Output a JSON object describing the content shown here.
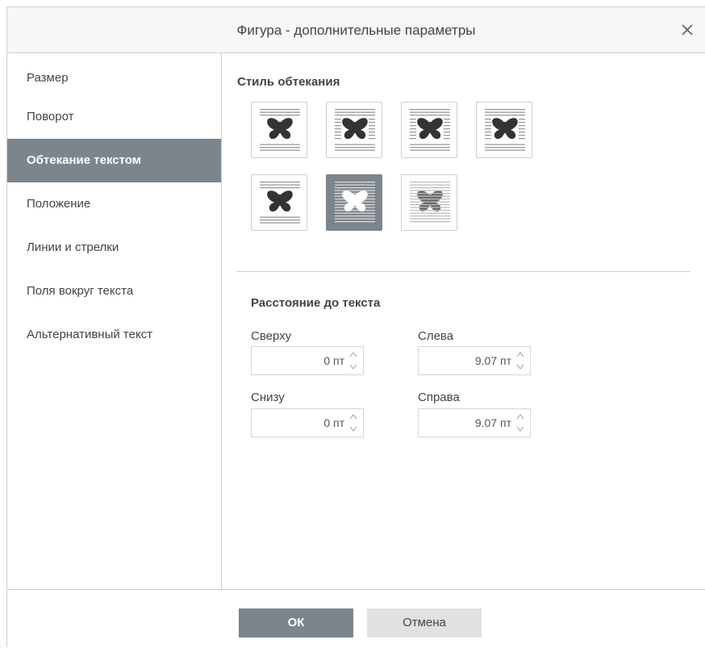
{
  "dialog": {
    "title": "Фигура - дополнительные параметры",
    "close_icon": "close-icon"
  },
  "sidebar": {
    "items": [
      {
        "label": "Размер",
        "active": false
      },
      {
        "label": "Поворот",
        "active": false
      },
      {
        "label": "Обтекание текстом",
        "active": true
      },
      {
        "label": "Положение",
        "active": false
      },
      {
        "label": "Линии и стрелки",
        "active": false
      },
      {
        "label": "Поля вокруг текста",
        "active": false
      },
      {
        "label": "Альтернативный текст",
        "active": false
      }
    ]
  },
  "wrap": {
    "title": "Стиль обтекания",
    "styles": [
      {
        "icon": "wrap-inline-icon",
        "selected": false
      },
      {
        "icon": "wrap-square-icon",
        "selected": false
      },
      {
        "icon": "wrap-tight-icon",
        "selected": false
      },
      {
        "icon": "wrap-through-icon",
        "selected": false
      },
      {
        "icon": "wrap-top-bottom-icon",
        "selected": false
      },
      {
        "icon": "wrap-in-front-icon",
        "selected": true
      },
      {
        "icon": "wrap-behind-icon",
        "selected": false
      }
    ]
  },
  "distance": {
    "title": "Расстояние до текста",
    "top_label": "Сверху",
    "top_value": "0 пт",
    "left_label": "Слева",
    "left_value": "9.07 пт",
    "bottom_label": "Снизу",
    "bottom_value": "0 пт",
    "right_label": "Справа",
    "right_value": "9.07 пт"
  },
  "footer": {
    "ok_label": "ОК",
    "cancel_label": "Отмена"
  },
  "colors": {
    "accent": "#7d858c",
    "border": "#cfcfcf",
    "cancel_bg": "#e1e1e1"
  }
}
